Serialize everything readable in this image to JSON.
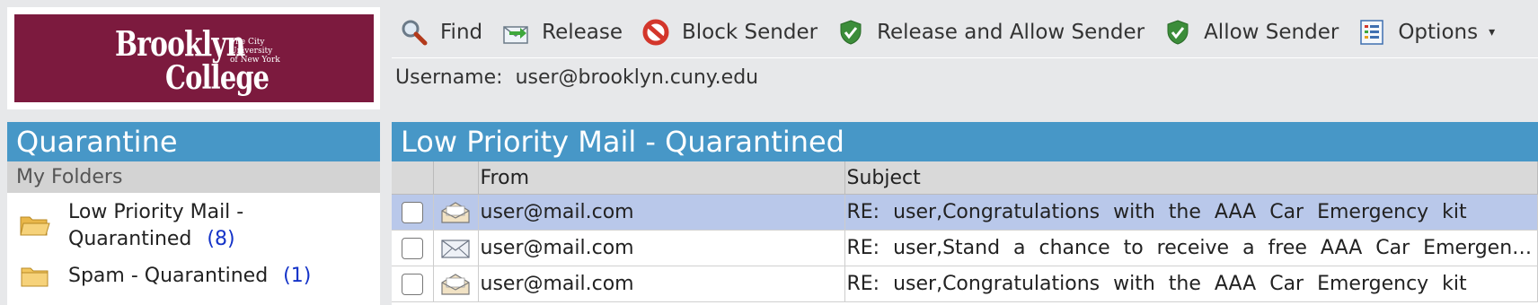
{
  "logo": {
    "word1": "Brooklyn",
    "word2": "College",
    "tagline": [
      "The City",
      "University",
      "of New York"
    ],
    "color": "#7c1a3e"
  },
  "toolbar": {
    "items": [
      {
        "label": "Find",
        "icon": "magnifier-icon"
      },
      {
        "label": "Release",
        "icon": "envelope-arrow-icon"
      },
      {
        "label": "Block Sender",
        "icon": "block-icon"
      },
      {
        "label": "Release and Allow Sender",
        "icon": "shield-check-icon"
      },
      {
        "label": "Allow Sender",
        "icon": "shield-check-icon"
      },
      {
        "label": "Options",
        "icon": "options-list-icon",
        "caret": "▾"
      }
    ]
  },
  "user": {
    "label": "Username:",
    "value": "user@brooklyn.cuny.edu"
  },
  "sidebar": {
    "title": "Quarantine",
    "subheader": "My Folders",
    "folders": [
      {
        "label_line1": "Low Priority Mail -",
        "label_line2": "Quarantined",
        "count": "(8)",
        "icon": "open-folder-icon"
      },
      {
        "label": "Spam - Quarantined",
        "count": "(1)",
        "icon": "folder-icon"
      }
    ]
  },
  "main": {
    "title": "Low Priority Mail - Quarantined",
    "columns": [
      "",
      "",
      "From",
      "Subject"
    ],
    "rows": [
      {
        "from": "user@mail.com",
        "subject": "RE: user,Congratulations with the AAA Car Emergency kit",
        "icon": "open-envelope-icon",
        "selected": true
      },
      {
        "from": "user@mail.com",
        "subject": "RE: user,Stand a chance to receive a free AAA Car Emergenc...",
        "icon": "closed-envelope-icon",
        "selected": false
      },
      {
        "from": "user@mail.com",
        "subject": "RE: user,Congratulations with the AAA Car Emergency kit",
        "icon": "open-envelope-icon",
        "selected": false
      }
    ]
  },
  "colors": {
    "header_blue": "#4797c7",
    "selected_row": "#b9c8ea",
    "count_link": "#1433c8"
  }
}
